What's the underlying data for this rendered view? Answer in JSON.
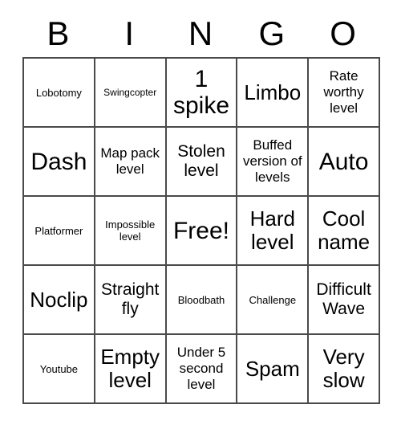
{
  "card": {
    "header_letters": [
      "B",
      "I",
      "N",
      "G",
      "O"
    ],
    "rows": [
      [
        {
          "label": "Lobotomy",
          "size": "fs-xs"
        },
        {
          "label": "Swingcopter",
          "size": "fs-xxs"
        },
        {
          "label": "1 spike",
          "size": "fs-xl"
        },
        {
          "label": "Limbo",
          "size": "fs-lg"
        },
        {
          "label": "Rate worthy level",
          "size": "fs-sm"
        }
      ],
      [
        {
          "label": "Dash",
          "size": "fs-xl"
        },
        {
          "label": "Map pack level",
          "size": "fs-sm"
        },
        {
          "label": "Stolen level",
          "size": "fs-md"
        },
        {
          "label": "Buffed version of levels",
          "size": "fs-sm"
        },
        {
          "label": "Auto",
          "size": "fs-xl"
        }
      ],
      [
        {
          "label": "Platformer",
          "size": "fs-xs"
        },
        {
          "label": "Impossible level",
          "size": "fs-xs"
        },
        {
          "label": "Free!",
          "size": "fs-xl"
        },
        {
          "label": "Hard level",
          "size": "fs-lg"
        },
        {
          "label": "Cool name",
          "size": "fs-lg"
        }
      ],
      [
        {
          "label": "Noclip",
          "size": "fs-lg"
        },
        {
          "label": "Straight fly",
          "size": "fs-md"
        },
        {
          "label": "Bloodbath",
          "size": "fs-xs"
        },
        {
          "label": "Challenge",
          "size": "fs-xs"
        },
        {
          "label": "Difficult Wave",
          "size": "fs-md"
        }
      ],
      [
        {
          "label": "Youtube",
          "size": "fs-xs"
        },
        {
          "label": "Empty level",
          "size": "fs-lg"
        },
        {
          "label": "Under 5 second level",
          "size": "fs-sm"
        },
        {
          "label": "Spam",
          "size": "fs-lg"
        },
        {
          "label": "Very slow",
          "size": "fs-lg"
        }
      ]
    ]
  }
}
